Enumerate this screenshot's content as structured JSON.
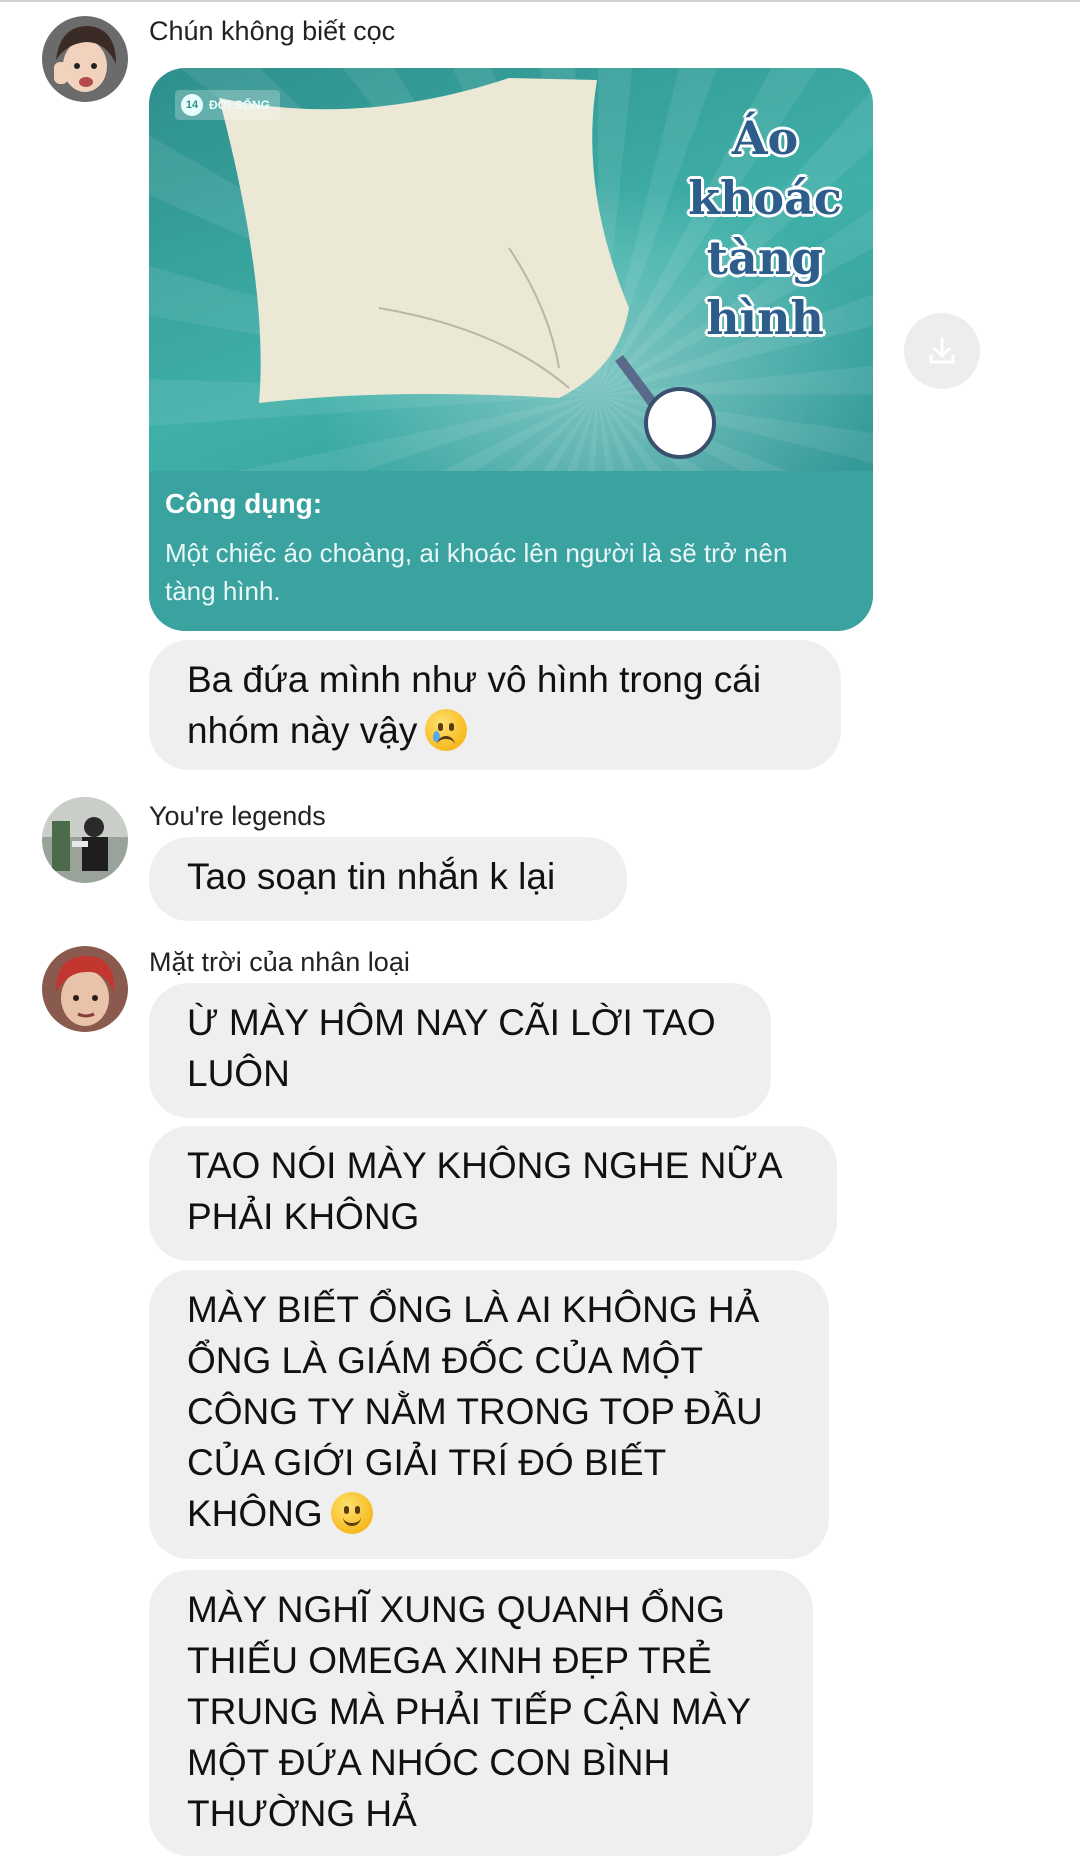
{
  "messages": [
    {
      "sender": "Chún không biết cọc",
      "card": {
        "badge": "ĐỜI SỐNG",
        "badge_num": "14",
        "title_lines": [
          "Áo",
          "khoác",
          "tàng",
          "hình"
        ],
        "label": "Công dụng:",
        "description": "Một chiếc áo choàng, ai khoác lên người là sẽ trở nên tàng hình."
      },
      "bubble_lines": [
        "Ba đứa mình như vô hình trong cái",
        "nhóm này vậy"
      ]
    },
    {
      "sender": "You're legends",
      "bubble_lines": [
        "Tao soạn tin nhắn k lại"
      ]
    },
    {
      "sender": "Mặt trời của nhân loại",
      "bubbles": [
        [
          "Ừ MÀY HÔM NAY CÃI LỜI TAO",
          "LUÔN"
        ],
        [
          "TAO NÓI MÀY KHÔNG NGHE NỮA",
          "PHẢI KHÔNG"
        ],
        [
          "MÀY BIẾT ỔNG LÀ AI KHÔNG HẢ",
          "ỔNG LÀ GIÁM ĐỐC CỦA MỘT",
          "CÔNG TY NẰM TRONG TOP ĐẦU",
          "CỦA GIỚI GIẢI TRÍ ĐÓ BIẾT",
          "KHÔNG"
        ],
        [
          "MÀY NGHĨ XUNG QUANH ỔNG",
          "THIẾU OMEGA XINH ĐẸP TRẺ",
          "TRUNG MÀ PHẢI TIẾP CẬN MÀY",
          "MỘT ĐỨA NHÓC CON BÌNH",
          "THƯỜNG HẢ"
        ]
      ]
    }
  ],
  "icons": {
    "download": "download-icon",
    "emoji_sad": "crying-face-emoji",
    "emoji_smile": "smiling-face-emoji"
  },
  "colors": {
    "bubble": "#efefef",
    "card_teal": "#3aa3a0",
    "title_blue": "#2d5d8a"
  }
}
